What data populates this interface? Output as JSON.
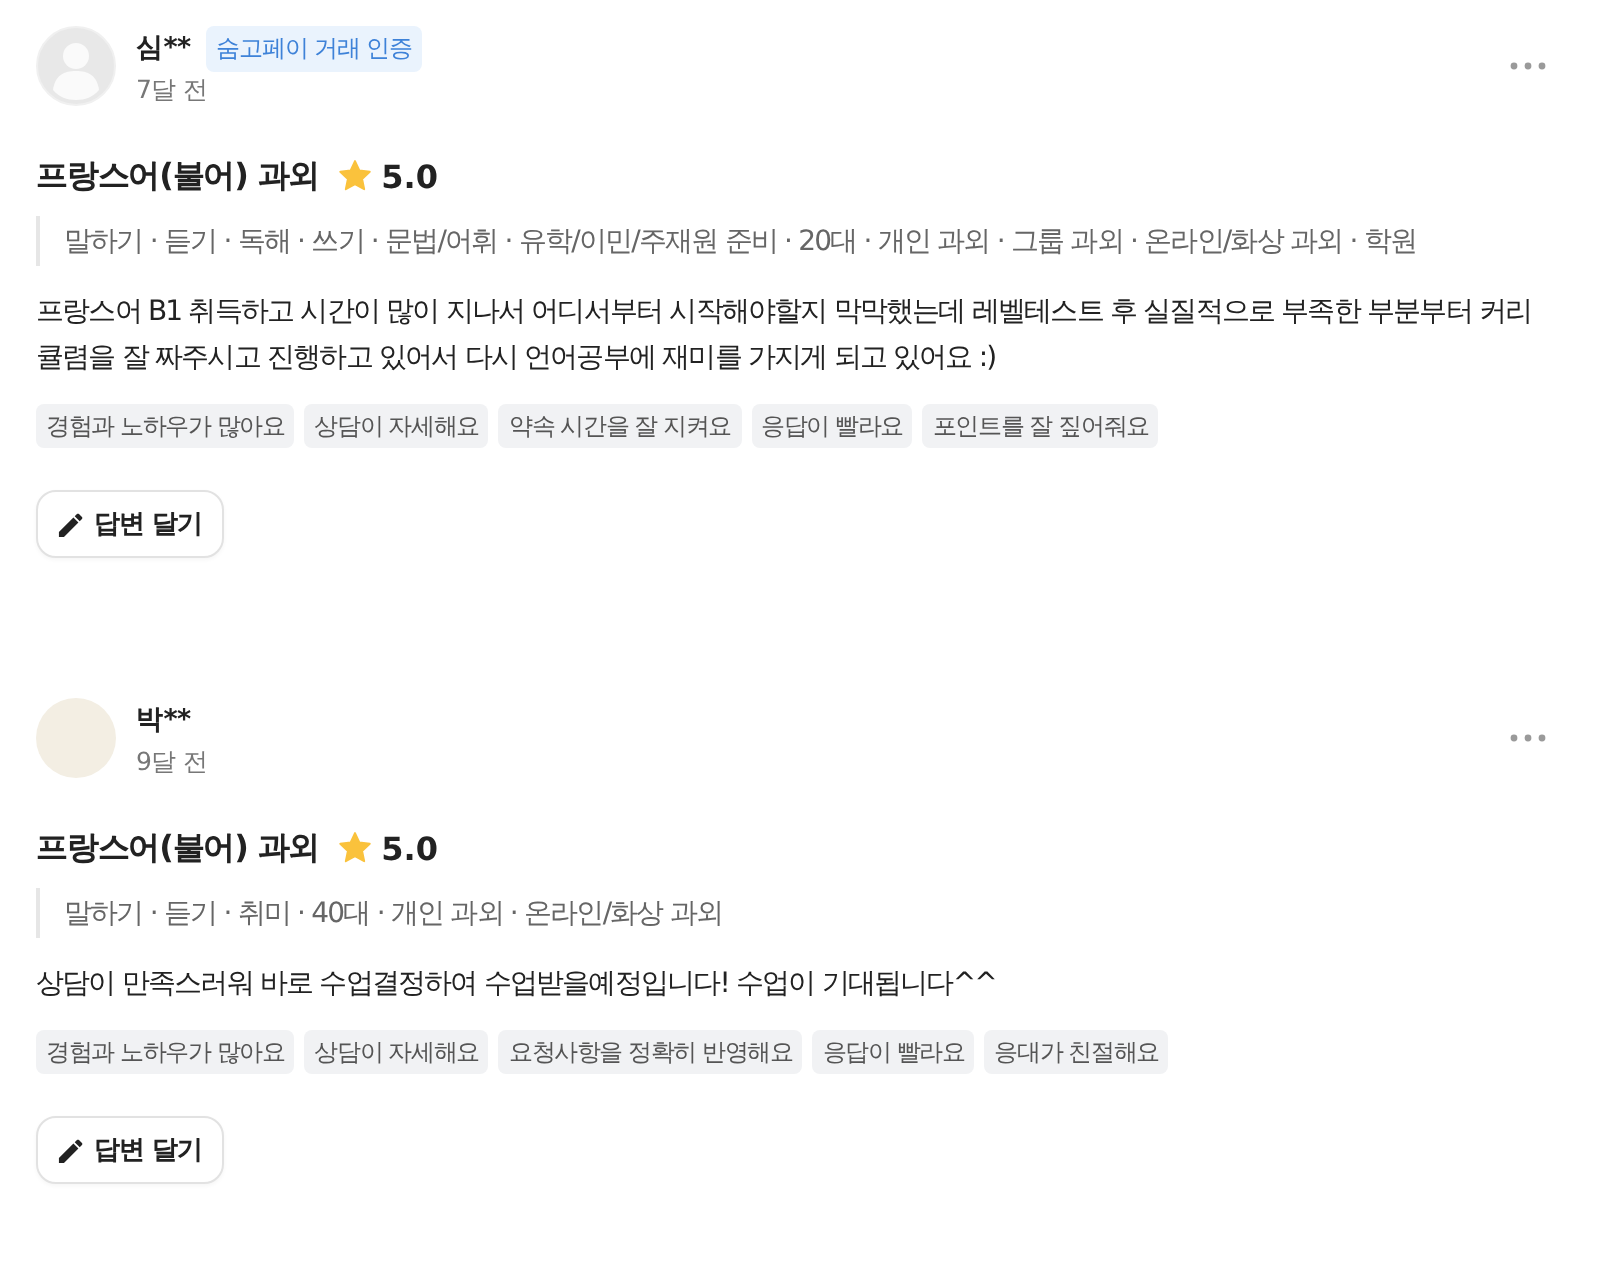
{
  "reviews": [
    {
      "avatar": {
        "kind": "default"
      },
      "author": "심**",
      "badge": "숨고페이 거래 인증",
      "time": "7달 전",
      "service": "프랑스어(불어) 과외",
      "rating": "5.0",
      "details": "말하기 · 듣기 · 독해 · 쓰기 · 문법/어휘 · 유학/이민/주재원 준비 · 20대 · 개인 과외 · 그룹 과외 · 온라인/화상 과외 · 학원",
      "text": "프랑스어 B1 취득하고 시간이 많이 지나서 어디서부터 시작해야할지 막막했는데 레벨테스트 후 실질적으로 부족한 부분부터 커리큘렴을 잘 짜주시고 진행하고 있어서 다시 언어공부에 재미를 가지게 되고 있어요 :)",
      "keywords": [
        "경험과 노하우가 많아요",
        "상담이 자세해요",
        "약속 시간을 잘 지켜요",
        "응답이 빨라요",
        "포인트를 잘 짚어줘요"
      ],
      "reply_button": "답변 달기"
    },
    {
      "avatar": {
        "kind": "image"
      },
      "author": "박**",
      "time": "9달 전",
      "service": "프랑스어(불어) 과외",
      "rating": "5.0",
      "details": "말하기 · 듣기 · 취미 · 40대 · 개인 과외 · 온라인/화상 과외",
      "text": "상담이 만족스러워 바로 수업결정하여 수업받을예정입니다! 수업이 기대됩니다^^",
      "keywords": [
        "경험과 노하우가 많아요",
        "상담이 자세해요",
        "요청사항을 정확히 반영해요",
        "응답이 빨라요",
        "응대가 친절해요"
      ],
      "reply_button": "답변 달기"
    }
  ]
}
